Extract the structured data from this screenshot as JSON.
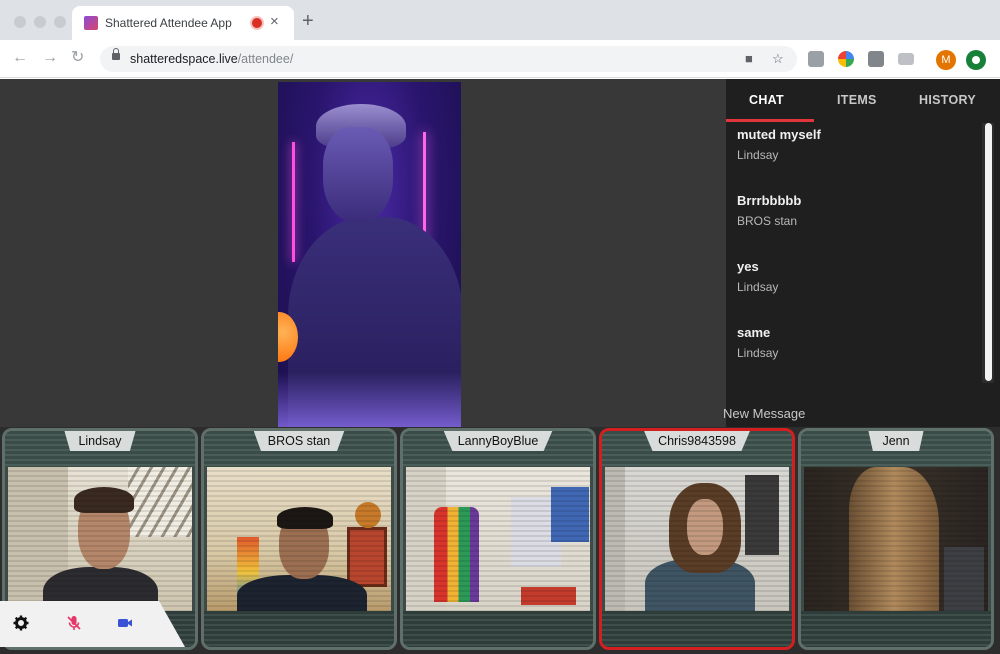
{
  "browser": {
    "tab_title": "Shattered Attendee App",
    "tab_close": "×",
    "new_tab": "+",
    "url_domain": "shatteredspace.live",
    "url_path": "/attendee/",
    "profile_initial": "M",
    "nav": {
      "back": "←",
      "forward": "→",
      "reload": "↻"
    },
    "omni_icons": {
      "camera": "■",
      "star": "☆"
    }
  },
  "sidebar": {
    "tabs": [
      {
        "label": "CHAT",
        "active": true
      },
      {
        "label": "ITEMS",
        "active": false
      },
      {
        "label": "HISTORY",
        "active": false
      }
    ],
    "messages": [
      {
        "text": "muted myself",
        "author": "Lindsay"
      },
      {
        "text": "Brrrbbbbb",
        "author": "BROS stan"
      },
      {
        "text": "yes",
        "author": "Lindsay"
      },
      {
        "text": "same",
        "author": "Lindsay"
      }
    ],
    "input_placeholder": "New Message"
  },
  "participants": [
    {
      "name": "Lindsay",
      "active": false
    },
    {
      "name": "BROS stan",
      "active": false
    },
    {
      "name": "LannyBoyBlue",
      "active": false
    },
    {
      "name": "Chris9843598",
      "active": true
    },
    {
      "name": "Jenn",
      "active": false
    }
  ],
  "controls": {
    "settings_icon": "gear-icon",
    "mic_icon": "mic-muted-icon",
    "camera_icon": "camera-icon"
  },
  "colors": {
    "accent_red": "#e0353b",
    "active_border": "#d31f1f",
    "tile_border": "#5f6f6a"
  }
}
